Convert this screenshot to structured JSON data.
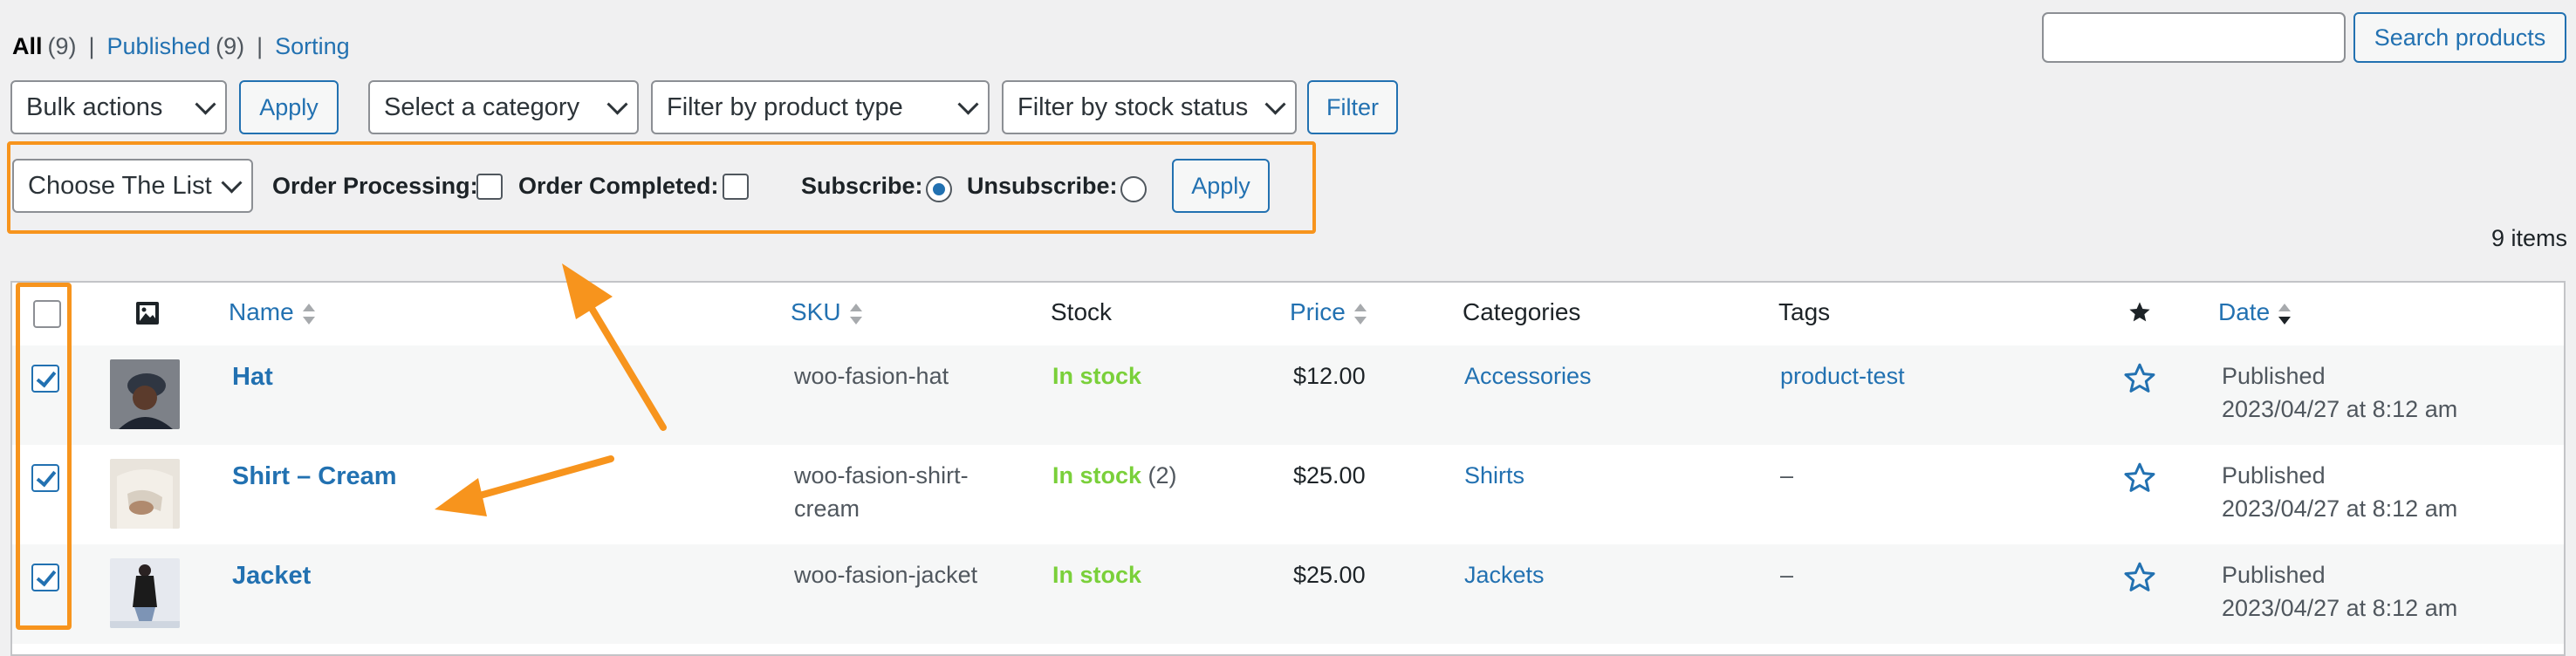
{
  "views": {
    "all_label": "All",
    "all_count": "(9)",
    "published_label": "Published",
    "published_count": "(9)",
    "sorting_label": "Sorting",
    "separator": "|"
  },
  "search": {
    "button_label": "Search products",
    "value": ""
  },
  "filters": {
    "bulk_actions": "Bulk actions",
    "apply_label": "Apply",
    "category": "Select a category",
    "product_type": "Filter by product type",
    "stock_status": "Filter by stock status",
    "filter_label": "Filter"
  },
  "list_tools": {
    "choose_list": "Choose The List",
    "order_processing": "Order Processing:",
    "order_completed": "Order Completed:",
    "subscribe": "Subscribe:",
    "unsubscribe": "Unsubscribe:",
    "apply_label": "Apply",
    "subscribe_selected": true
  },
  "items_count": "9 items",
  "table": {
    "columns": {
      "name": "Name",
      "sku": "SKU",
      "stock": "Stock",
      "price": "Price",
      "categories": "Categories",
      "tags": "Tags",
      "date": "Date"
    },
    "rows": [
      {
        "name": "Hat",
        "sku": "woo-fasion-hat",
        "sku2": "",
        "stock": "In stock",
        "stock_qty": "",
        "price": "$12.00",
        "category": "Accessories",
        "tags": "product-test",
        "status": "Published",
        "date": "2023/04/27 at 8:12 am",
        "checked": true
      },
      {
        "name": "Shirt – Cream",
        "sku": "woo-fasion-shirt-",
        "sku2": "cream",
        "stock": "In stock",
        "stock_qty": "(2)",
        "price": "$25.00",
        "category": "Shirts",
        "tags": "–",
        "status": "Published",
        "date": "2023/04/27 at 8:12 am",
        "checked": true
      },
      {
        "name": "Jacket",
        "sku": "woo-fasion-jacket",
        "sku2": "",
        "stock": "In stock",
        "stock_qty": "",
        "price": "$25.00",
        "category": "Jackets",
        "tags": "–",
        "status": "Published",
        "date": "2023/04/27 at 8:12 am",
        "checked": true
      }
    ]
  },
  "colors": {
    "accent": "#2271b1",
    "highlight": "#f7941d",
    "in_stock": "#7ad03a"
  }
}
